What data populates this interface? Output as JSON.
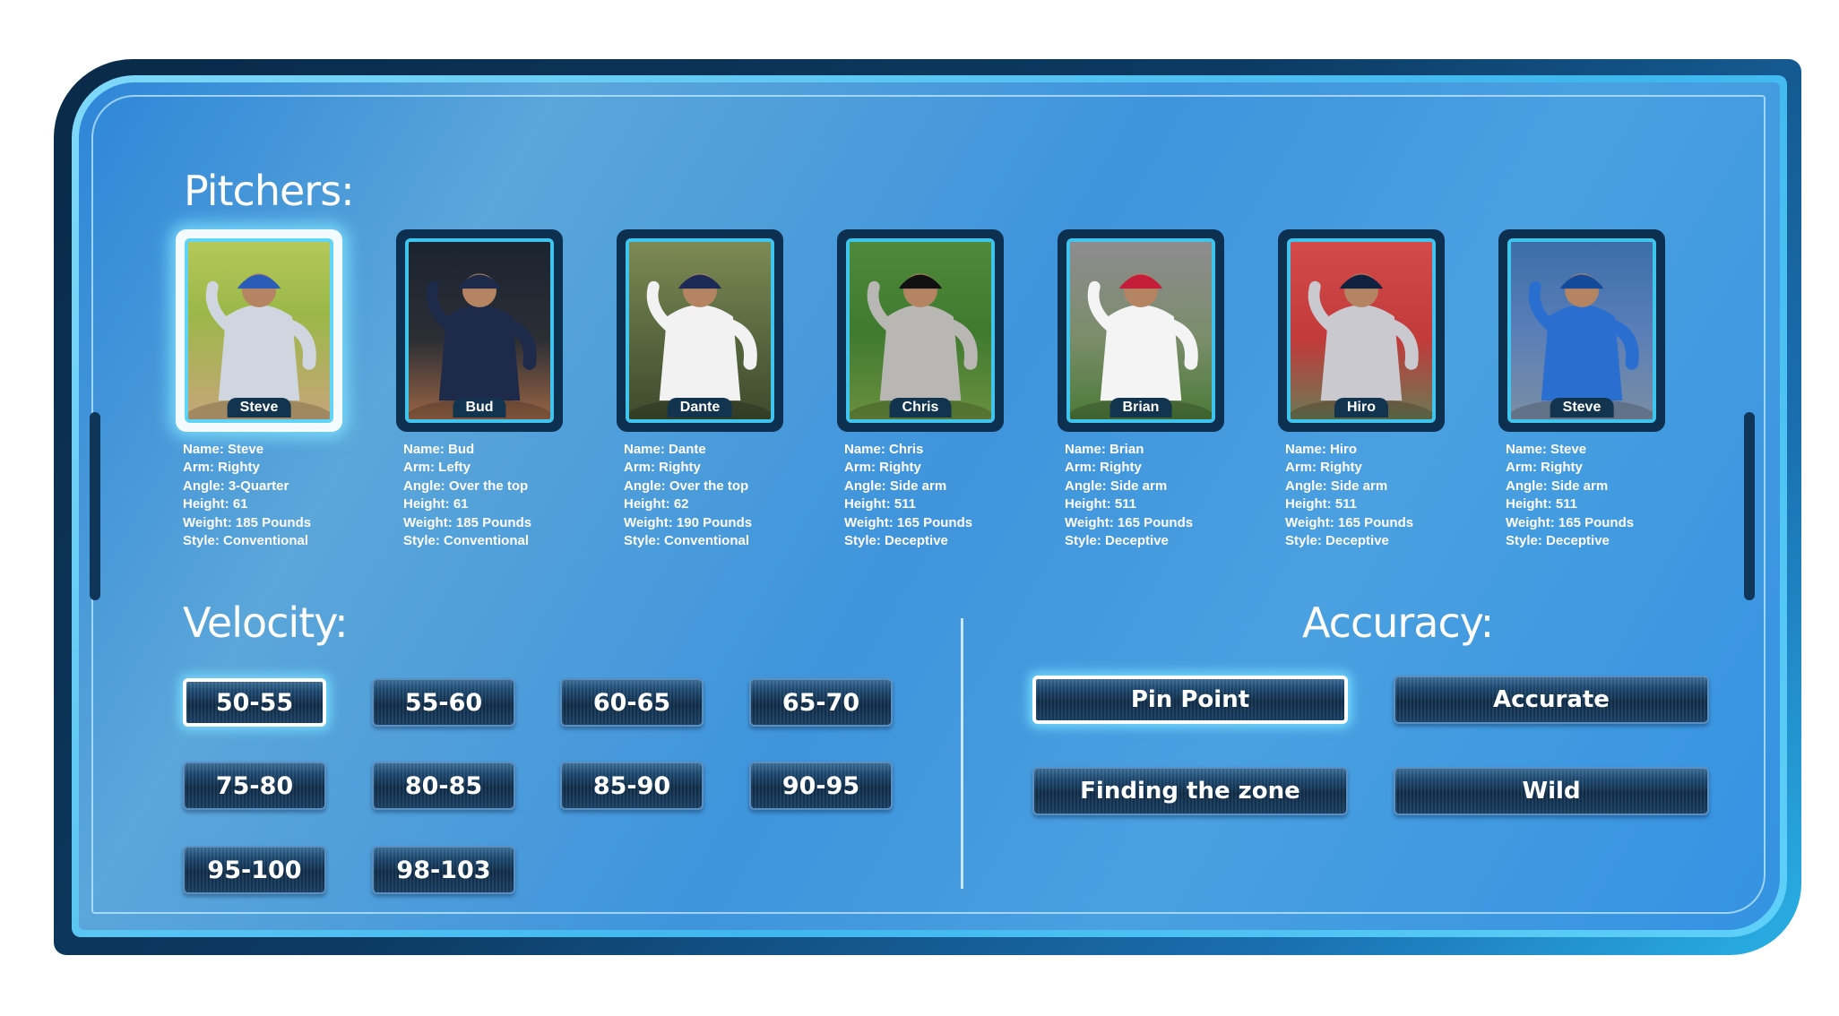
{
  "sections": {
    "pitchers_title": "Pitchers:",
    "velocity_title": "Velocity:",
    "accuracy_title": "Accuracy:"
  },
  "pitchers": [
    {
      "name": "Steve",
      "arm": "Arm: Righty",
      "angle": "Angle: 3-Quarter",
      "height": "Height: 61",
      "weight": "Weight: 185 Pounds",
      "style": "Style: Conventional",
      "name_line": "Name: Steve",
      "selected": true
    },
    {
      "name": "Bud",
      "arm": "Arm: Lefty",
      "angle": "Angle: Over the top",
      "height": "Height: 61",
      "weight": "Weight: 185 Pounds",
      "style": "Style: Conventional",
      "name_line": "Name: Bud",
      "selected": false
    },
    {
      "name": "Dante",
      "arm": "Arm: Righty",
      "angle": "Angle: Over the top",
      "height": "Height: 62",
      "weight": "Weight: 190 Pounds",
      "style": "Style: Conventional",
      "name_line": "Name: Dante",
      "selected": false
    },
    {
      "name": "Chris",
      "arm": "Arm: Righty",
      "angle": "Angle: Side arm",
      "height": "Height: 511",
      "weight": "Weight: 165 Pounds",
      "style": "Style: Deceptive",
      "name_line": "Name: Chris",
      "selected": false
    },
    {
      "name": "Brian",
      "arm": "Arm: Righty",
      "angle": "Angle: Side arm",
      "height": "Height: 511",
      "weight": "Weight: 165 Pounds",
      "style": "Style: Deceptive",
      "name_line": "Name: Brian",
      "selected": false
    },
    {
      "name": "Hiro",
      "arm": "Arm: Righty",
      "angle": "Angle: Side arm",
      "height": "Height: 511",
      "weight": "Weight: 165 Pounds",
      "style": "Style: Deceptive",
      "name_line": "Name: Hiro",
      "selected": false
    },
    {
      "name": "Steve",
      "arm": "Arm: Righty",
      "angle": "Angle: Side arm",
      "height": "Height: 511",
      "weight": "Weight: 165 Pounds",
      "style": "Style: Deceptive",
      "name_line": "Name: Steve",
      "selected": false
    }
  ],
  "velocity": [
    "50-55",
    "55-60",
    "60-65",
    "65-70",
    "75-80",
    "80-85",
    "85-90",
    "90-95",
    "95-100",
    "98-103"
  ],
  "velocity_selected": "50-55",
  "accuracy": [
    "Pin Point",
    "Accurate",
    "Finding the zone",
    "Wild"
  ],
  "accuracy_selected": "Pin Point",
  "colors": {
    "panel_blue": "#3f94dc",
    "frame_dark": "#0c3a62",
    "glow": "#7fd8f8",
    "button_dark": "#0f2c48"
  }
}
